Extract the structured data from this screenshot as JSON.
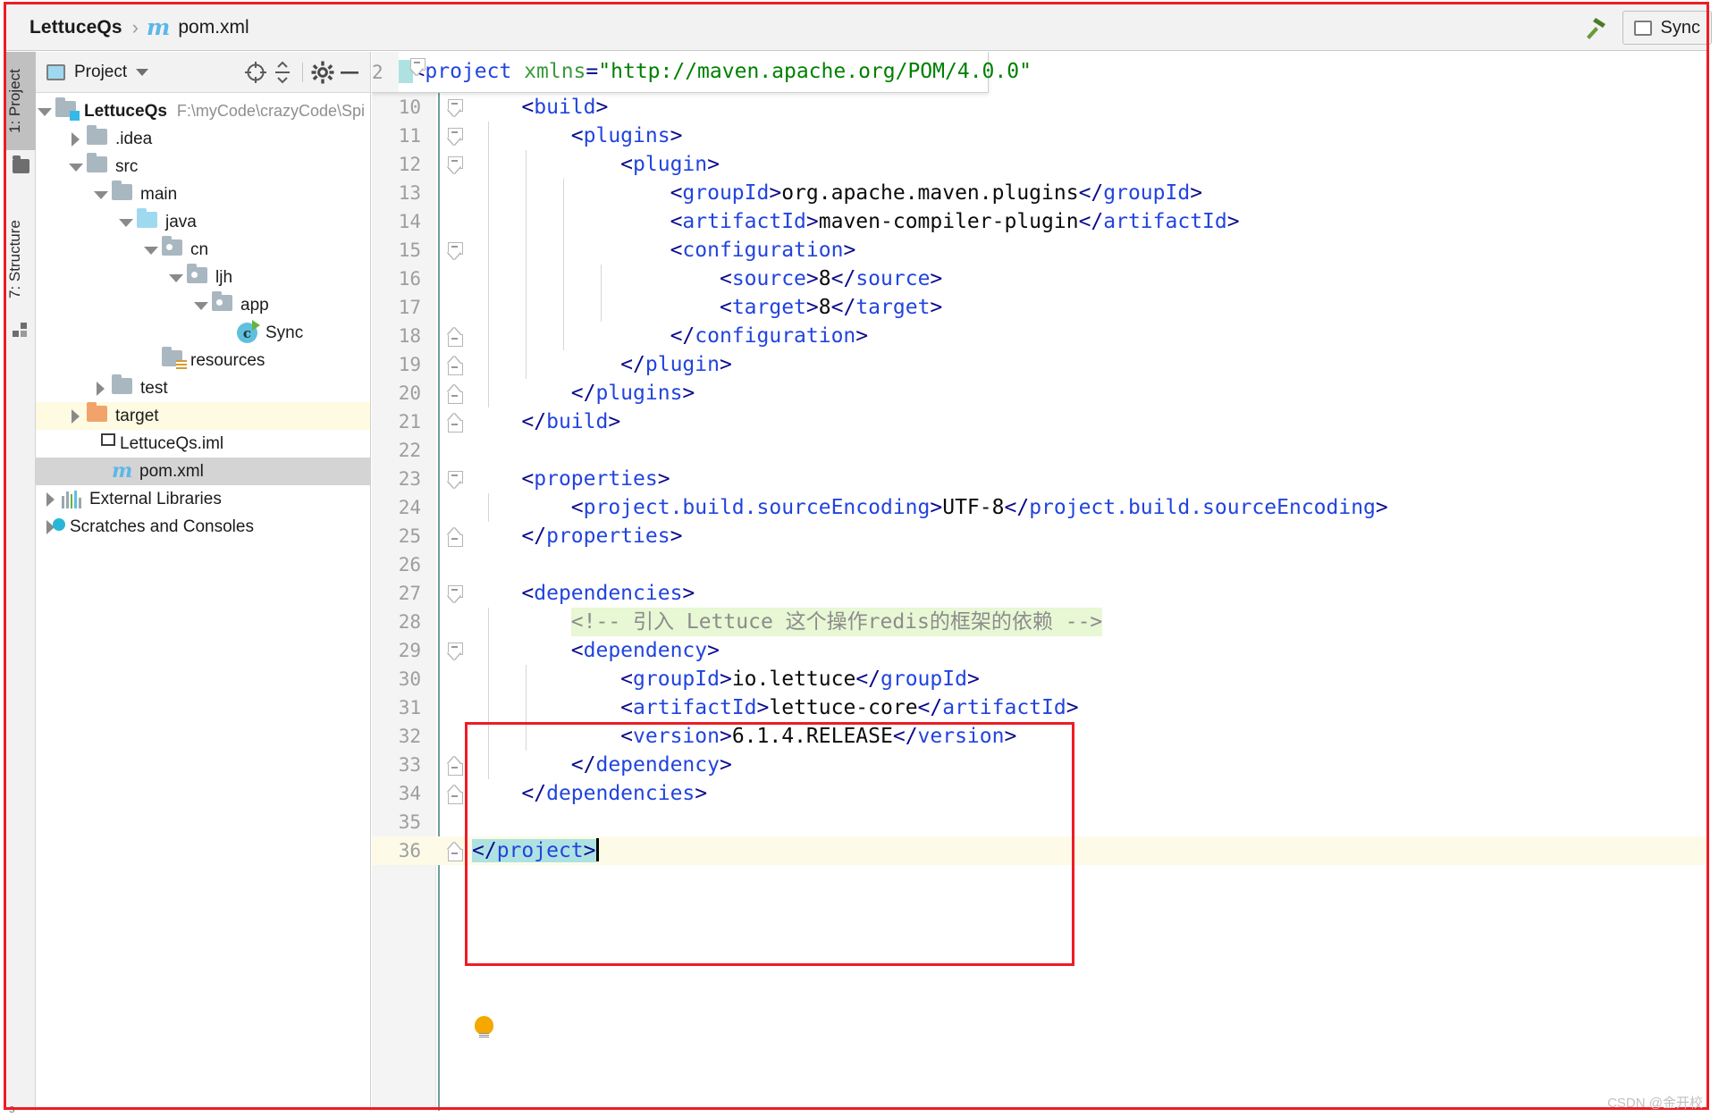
{
  "breadcrumb": {
    "root": "LettuceQs",
    "separator": "›",
    "file_icon": "m",
    "file": "pom.xml"
  },
  "toolbar_right": {
    "hammer_icon": "hammer-icon",
    "sync_icon": "sync-window-icon",
    "sync_label": "Sync"
  },
  "tool_strip": {
    "project_tab": "1: Project",
    "structure_tab": "7: Structure",
    "folder_icon": "folder-icon",
    "structure_icon": "structure-icon"
  },
  "project_panel": {
    "title": "Project",
    "panel_icon": "project-panel-icon",
    "caret_icon": "chevron-down-icon",
    "locate_icon": "crosshair-target-icon",
    "collapse_icon": "collapse-all-icon",
    "settings_icon": "gear-icon",
    "hide_icon": "minimize-icon",
    "tree": [
      {
        "label": "LettuceQs",
        "path": "F:\\myCode\\crazyCode\\Spi",
        "icon": "project-folder-icon",
        "indent": 0,
        "twisty": "down",
        "bold": true,
        "state": "normal"
      },
      {
        "label": ".idea",
        "path": "",
        "icon": "folder-gray-icon",
        "indent": 1,
        "twisty": "right",
        "bold": false,
        "state": "normal"
      },
      {
        "label": "src",
        "path": "",
        "icon": "folder-gray-icon",
        "indent": 1,
        "twisty": "down",
        "bold": false,
        "state": "normal"
      },
      {
        "label": "main",
        "path": "",
        "icon": "folder-gray-icon",
        "indent": 2,
        "twisty": "down",
        "bold": false,
        "state": "normal"
      },
      {
        "label": "java",
        "path": "",
        "icon": "folder-sources-icon",
        "indent": 3,
        "twisty": "down",
        "bold": false,
        "state": "normal"
      },
      {
        "label": "cn",
        "path": "",
        "icon": "package-icon",
        "indent": 4,
        "twisty": "down",
        "bold": false,
        "state": "normal"
      },
      {
        "label": "ljh",
        "path": "",
        "icon": "package-icon",
        "indent": 5,
        "twisty": "down",
        "bold": false,
        "state": "normal"
      },
      {
        "label": "app",
        "path": "",
        "icon": "package-icon",
        "indent": 6,
        "twisty": "down",
        "bold": false,
        "state": "normal"
      },
      {
        "label": "Sync",
        "path": "",
        "icon": "java-class-runnable-icon",
        "indent": 7,
        "twisty": "none",
        "bold": false,
        "state": "normal"
      },
      {
        "label": "resources",
        "path": "",
        "icon": "folder-resources-icon",
        "indent": 4,
        "twisty": "none",
        "bold": false,
        "state": "normal"
      },
      {
        "label": "test",
        "path": "",
        "icon": "folder-gray-icon",
        "indent": 2,
        "twisty": "right",
        "bold": false,
        "state": "normal"
      },
      {
        "label": "target",
        "path": "",
        "icon": "folder-excluded-icon",
        "indent": 1,
        "twisty": "right",
        "bold": false,
        "state": "highlighted"
      },
      {
        "label": "LettuceQs.iml",
        "path": "",
        "icon": "iml-file-icon",
        "indent": 2,
        "twisty": "none",
        "bold": false,
        "state": "normal"
      },
      {
        "label": "pom.xml",
        "path": "",
        "icon": "maven-pom-icon",
        "indent": 2,
        "twisty": "none",
        "bold": false,
        "state": "selected"
      },
      {
        "label": "External Libraries",
        "path": "",
        "icon": "libraries-icon",
        "indent": 0,
        "twisty": "right",
        "bold": false,
        "state": "normal"
      },
      {
        "label": "Scratches and Consoles",
        "path": "",
        "icon": "scratches-icon",
        "indent": 0,
        "twisty": "right",
        "bold": false,
        "state": "normal"
      }
    ]
  },
  "editor": {
    "sticky_line": {
      "number": "2",
      "segments": [
        {
          "t": "<",
          "c": "br"
        },
        {
          "t": "project",
          "c": "tag"
        },
        {
          "t": " ",
          "c": "txt"
        },
        {
          "t": "xmlns",
          "c": "att"
        },
        {
          "t": "=",
          "c": "br"
        },
        {
          "t": "\"http://maven.apache.org/POM/4.0.0\"",
          "c": "str"
        }
      ]
    },
    "lines": [
      {
        "n": "10",
        "indent": 1,
        "fold": "open",
        "guides": 0,
        "current": false,
        "segments": [
          {
            "t": "<",
            "c": "br"
          },
          {
            "t": "build",
            "c": "tag"
          },
          {
            "t": ">",
            "c": "br"
          }
        ]
      },
      {
        "n": "11",
        "indent": 2,
        "fold": "open",
        "guides": 1,
        "current": false,
        "segments": [
          {
            "t": "<",
            "c": "br"
          },
          {
            "t": "plugins",
            "c": "tag"
          },
          {
            "t": ">",
            "c": "br"
          }
        ]
      },
      {
        "n": "12",
        "indent": 3,
        "fold": "open",
        "guides": 2,
        "current": false,
        "segments": [
          {
            "t": "<",
            "c": "br"
          },
          {
            "t": "plugin",
            "c": "tag"
          },
          {
            "t": ">",
            "c": "br"
          }
        ]
      },
      {
        "n": "13",
        "indent": 4,
        "fold": "none",
        "guides": 3,
        "current": false,
        "segments": [
          {
            "t": "<",
            "c": "br"
          },
          {
            "t": "groupId",
            "c": "tag"
          },
          {
            "t": ">",
            "c": "br"
          },
          {
            "t": "org.apache.maven.plugins",
            "c": "txt"
          },
          {
            "t": "</",
            "c": "br"
          },
          {
            "t": "groupId",
            "c": "tag"
          },
          {
            "t": ">",
            "c": "br"
          }
        ]
      },
      {
        "n": "14",
        "indent": 4,
        "fold": "none",
        "guides": 3,
        "current": false,
        "segments": [
          {
            "t": "<",
            "c": "br"
          },
          {
            "t": "artifactId",
            "c": "tag"
          },
          {
            "t": ">",
            "c": "br"
          },
          {
            "t": "maven-compiler-plugin",
            "c": "txt"
          },
          {
            "t": "</",
            "c": "br"
          },
          {
            "t": "artifactId",
            "c": "tag"
          },
          {
            "t": ">",
            "c": "br"
          }
        ]
      },
      {
        "n": "15",
        "indent": 4,
        "fold": "open",
        "guides": 3,
        "current": false,
        "segments": [
          {
            "t": "<",
            "c": "br"
          },
          {
            "t": "configuration",
            "c": "tag"
          },
          {
            "t": ">",
            "c": "br"
          }
        ]
      },
      {
        "n": "16",
        "indent": 5,
        "fold": "none",
        "guides": 4,
        "current": false,
        "segments": [
          {
            "t": "<",
            "c": "br"
          },
          {
            "t": "source",
            "c": "tag"
          },
          {
            "t": ">",
            "c": "br"
          },
          {
            "t": "8",
            "c": "txt"
          },
          {
            "t": "</",
            "c": "br"
          },
          {
            "t": "source",
            "c": "tag"
          },
          {
            "t": ">",
            "c": "br"
          }
        ]
      },
      {
        "n": "17",
        "indent": 5,
        "fold": "none",
        "guides": 4,
        "current": false,
        "segments": [
          {
            "t": "<",
            "c": "br"
          },
          {
            "t": "target",
            "c": "tag"
          },
          {
            "t": ">",
            "c": "br"
          },
          {
            "t": "8",
            "c": "txt"
          },
          {
            "t": "</",
            "c": "br"
          },
          {
            "t": "target",
            "c": "tag"
          },
          {
            "t": ">",
            "c": "br"
          }
        ]
      },
      {
        "n": "18",
        "indent": 4,
        "fold": "end",
        "guides": 3,
        "current": false,
        "segments": [
          {
            "t": "</",
            "c": "br"
          },
          {
            "t": "configuration",
            "c": "tag"
          },
          {
            "t": ">",
            "c": "br"
          }
        ]
      },
      {
        "n": "19",
        "indent": 3,
        "fold": "end",
        "guides": 2,
        "current": false,
        "segments": [
          {
            "t": "</",
            "c": "br"
          },
          {
            "t": "plugin",
            "c": "tag"
          },
          {
            "t": ">",
            "c": "br"
          }
        ]
      },
      {
        "n": "20",
        "indent": 2,
        "fold": "end",
        "guides": 1,
        "current": false,
        "segments": [
          {
            "t": "</",
            "c": "br"
          },
          {
            "t": "plugins",
            "c": "tag"
          },
          {
            "t": ">",
            "c": "br"
          }
        ]
      },
      {
        "n": "21",
        "indent": 1,
        "fold": "end",
        "guides": 0,
        "current": false,
        "segments": [
          {
            "t": "</",
            "c": "br"
          },
          {
            "t": "build",
            "c": "tag"
          },
          {
            "t": ">",
            "c": "br"
          }
        ]
      },
      {
        "n": "22",
        "indent": 0,
        "fold": "none",
        "guides": 0,
        "current": false,
        "segments": []
      },
      {
        "n": "23",
        "indent": 1,
        "fold": "open",
        "guides": 0,
        "current": false,
        "segments": [
          {
            "t": "<",
            "c": "br"
          },
          {
            "t": "properties",
            "c": "tag"
          },
          {
            "t": ">",
            "c": "br"
          }
        ]
      },
      {
        "n": "24",
        "indent": 2,
        "fold": "none",
        "guides": 1,
        "current": false,
        "segments": [
          {
            "t": "<",
            "c": "br"
          },
          {
            "t": "project.build.sourceEncoding",
            "c": "tag"
          },
          {
            "t": ">",
            "c": "br"
          },
          {
            "t": "UTF-8",
            "c": "txt"
          },
          {
            "t": "</",
            "c": "br"
          },
          {
            "t": "project.build.sourceEncoding",
            "c": "tag"
          },
          {
            "t": ">",
            "c": "br"
          }
        ]
      },
      {
        "n": "25",
        "indent": 1,
        "fold": "end",
        "guides": 0,
        "current": false,
        "segments": [
          {
            "t": "</",
            "c": "br"
          },
          {
            "t": "properties",
            "c": "tag"
          },
          {
            "t": ">",
            "c": "br"
          }
        ]
      },
      {
        "n": "26",
        "indent": 0,
        "fold": "none",
        "guides": 0,
        "current": false,
        "segments": []
      },
      {
        "n": "27",
        "indent": 1,
        "fold": "open",
        "guides": 0,
        "current": false,
        "segments": [
          {
            "t": "<",
            "c": "br"
          },
          {
            "t": "dependencies",
            "c": "tag"
          },
          {
            "t": ">",
            "c": "br"
          }
        ]
      },
      {
        "n": "28",
        "indent": 2,
        "fold": "none",
        "guides": 1,
        "current": false,
        "comment": true,
        "segments": [
          {
            "t": "<!-- 引入 Lettuce 这个操作redis的框架的依赖 -->",
            "c": "cmt"
          }
        ]
      },
      {
        "n": "29",
        "indent": 2,
        "fold": "open",
        "guides": 1,
        "current": false,
        "segments": [
          {
            "t": "<",
            "c": "br"
          },
          {
            "t": "dependency",
            "c": "tag"
          },
          {
            "t": ">",
            "c": "br"
          }
        ]
      },
      {
        "n": "30",
        "indent": 3,
        "fold": "none",
        "guides": 2,
        "current": false,
        "segments": [
          {
            "t": "<",
            "c": "br"
          },
          {
            "t": "groupId",
            "c": "tag"
          },
          {
            "t": ">",
            "c": "br"
          },
          {
            "t": "io.lettuce",
            "c": "txt"
          },
          {
            "t": "</",
            "c": "br"
          },
          {
            "t": "groupId",
            "c": "tag"
          },
          {
            "t": ">",
            "c": "br"
          }
        ]
      },
      {
        "n": "31",
        "indent": 3,
        "fold": "none",
        "guides": 2,
        "current": false,
        "segments": [
          {
            "t": "<",
            "c": "br"
          },
          {
            "t": "artifactId",
            "c": "tag"
          },
          {
            "t": ">",
            "c": "br"
          },
          {
            "t": "lettuce-core",
            "c": "txt"
          },
          {
            "t": "</",
            "c": "br"
          },
          {
            "t": "artifactId",
            "c": "tag"
          },
          {
            "t": ">",
            "c": "br"
          }
        ]
      },
      {
        "n": "32",
        "indent": 3,
        "fold": "none",
        "guides": 2,
        "current": false,
        "segments": [
          {
            "t": "<",
            "c": "br"
          },
          {
            "t": "version",
            "c": "tag"
          },
          {
            "t": ">",
            "c": "br"
          },
          {
            "t": "6.1.4.RELEASE",
            "c": "txt"
          },
          {
            "t": "</",
            "c": "br"
          },
          {
            "t": "version",
            "c": "tag"
          },
          {
            "t": ">",
            "c": "br"
          }
        ]
      },
      {
        "n": "33",
        "indent": 2,
        "fold": "end",
        "guides": 1,
        "current": false,
        "segments": [
          {
            "t": "</",
            "c": "br"
          },
          {
            "t": "dependency",
            "c": "tag"
          },
          {
            "t": ">",
            "c": "br"
          }
        ]
      },
      {
        "n": "34",
        "indent": 1,
        "fold": "end",
        "guides": 0,
        "current": false,
        "segments": [
          {
            "t": "</",
            "c": "br"
          },
          {
            "t": "dependencies",
            "c": "tag"
          },
          {
            "t": ">",
            "c": "br"
          }
        ]
      },
      {
        "n": "35",
        "indent": 0,
        "fold": "none",
        "guides": 0,
        "current": false,
        "segments": []
      },
      {
        "n": "36",
        "indent": 0,
        "fold": "end",
        "guides": 0,
        "current": true,
        "selected": true,
        "segments": [
          {
            "t": "</",
            "c": "br"
          },
          {
            "t": "project",
            "c": "tag"
          },
          {
            "t": ">",
            "c": "br"
          }
        ]
      }
    ],
    "bulb_icon": "intention-bulb-icon",
    "annotation_box": "red-highlight-rectangle"
  },
  "watermark": "CSDN @金开校",
  "status_char": "s",
  "colors": {
    "annotation_red": "#ee1c25",
    "tag_blue": "#2244dd",
    "bracket_navy": "#0a0a8c",
    "string_green": "#008000",
    "attr_green": "#3a9a3a",
    "comment_gray": "#8c8c8c",
    "comment_highlight": "#e8f7d4",
    "selection_cyan": "#aee2e2",
    "current_line": "#fdfbe8",
    "tree_highlight": "#fffbe2",
    "tree_selected": "#d4d4d4"
  }
}
